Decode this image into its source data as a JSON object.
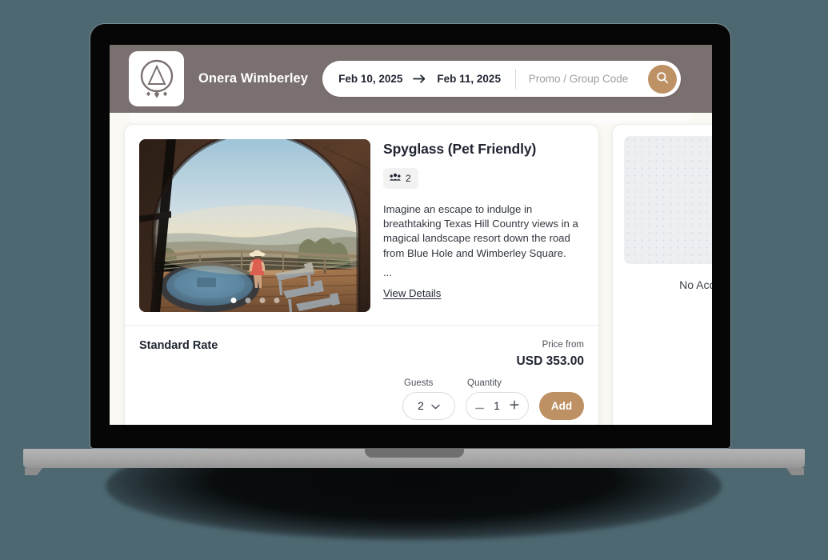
{
  "header": {
    "brand_name": "Onera Wimberley",
    "logo_icon": "onera-circle-tent-logo",
    "search": {
      "check_in": "Feb 10, 2025",
      "check_out": "Feb 11, 2025",
      "arrow_icon": "arrow-right-icon",
      "promo_value": "",
      "promo_placeholder": "Promo / Group Code",
      "search_icon": "search-icon"
    },
    "colors": {
      "header_bg": "#7b7070",
      "accent": "#bd9164"
    }
  },
  "main": {
    "room": {
      "title": "Spyglass (Pet Friendly)",
      "occupancy_icon": "guests-icon",
      "occupancy_count": "2",
      "description": "Imagine an escape to indulge in breathtaking Texas Hill Country views in a magical landscape resort down the road from Blue Hole and Wimberley Square.",
      "truncation": "...",
      "view_details_label": "View Details",
      "photo_alt": "woman-on-deck-with-hot-tub-at-sunset",
      "carousel": {
        "total_dots": 4,
        "active_index": 0
      },
      "rate": {
        "name": "Standard Rate",
        "price_label": "Price from",
        "price_amount": "USD 353.00",
        "guests_label": "Guests",
        "guests_value": "2",
        "guests_chevron_icon": "chevron-down-icon",
        "quantity_label": "Quantity",
        "quantity_value": "1",
        "decrement_icon": "minus-icon",
        "increment_icon": "plus-icon",
        "add_label": "Add"
      }
    },
    "secondary_room": {
      "placeholder_icon": "image-placeholder",
      "title": "No Accom"
    }
  },
  "device": {
    "frame": "laptop-mockup",
    "background_color": "#4e6872"
  }
}
